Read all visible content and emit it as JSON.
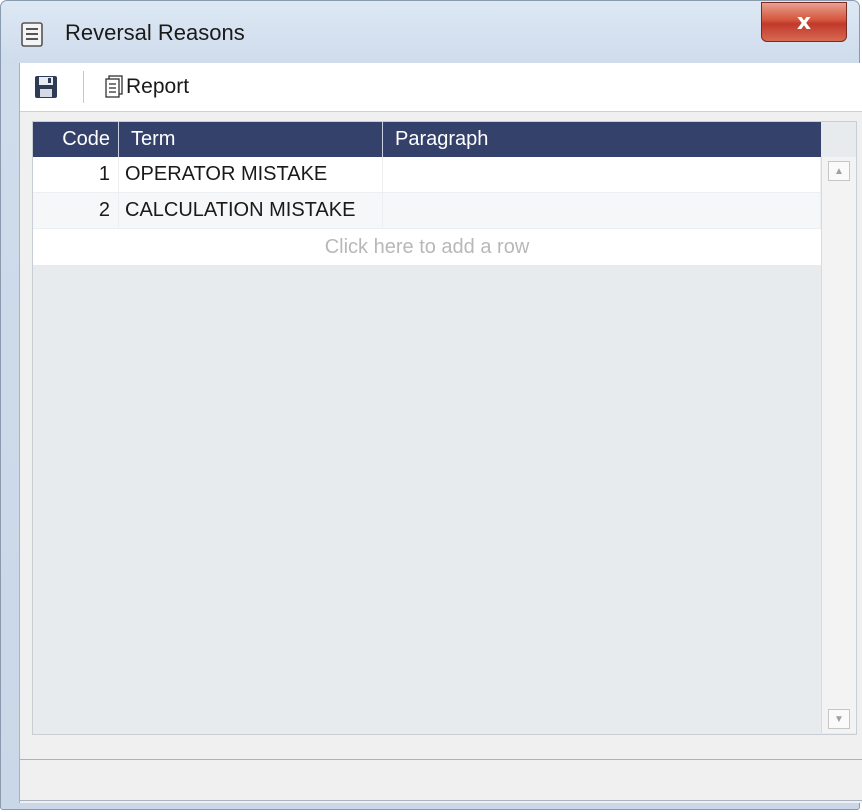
{
  "window": {
    "title": "Reversal Reasons",
    "close_symbol": "x"
  },
  "toolbar": {
    "save_icon": "save-icon",
    "report_label": "Report",
    "report_icon": "report-icon"
  },
  "grid": {
    "columns": [
      "Code",
      "Term",
      "Paragraph"
    ],
    "rows": [
      {
        "code": "1",
        "term": "OPERATOR MISTAKE",
        "paragraph": ""
      },
      {
        "code": "2",
        "term": "CALCULATION MISTAKE",
        "paragraph": ""
      }
    ],
    "add_row_text": "Click here to add a row"
  },
  "colors": {
    "header_bg": "#34416b",
    "close_button": "#c0392b"
  }
}
